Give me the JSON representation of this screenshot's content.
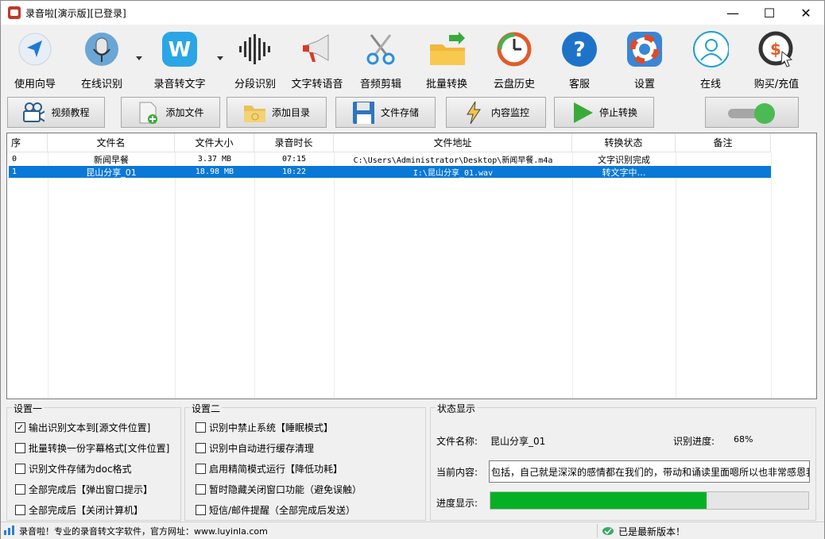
{
  "window": {
    "title": "录音啦[演示版][已登录]",
    "controls": [
      "—",
      "☐",
      "✕"
    ]
  },
  "toolbar": [
    {
      "label": "使用向导",
      "icon": "navigation-arrow-icon"
    },
    {
      "label": "在线识别",
      "icon": "microphone-icon"
    },
    {
      "label": "录音转文字",
      "icon": "w-logo-icon"
    },
    {
      "label": "分段识别",
      "icon": "soundwave-icon"
    },
    {
      "label": "文字转语音",
      "icon": "megaphone-icon"
    },
    {
      "label": "音频剪辑",
      "icon": "scissors-icon"
    },
    {
      "label": "批量转换",
      "icon": "folder-arrow-icon"
    },
    {
      "label": "云盘历史",
      "icon": "history-clock-icon"
    },
    {
      "label": "客服",
      "icon": "help-question-icon"
    },
    {
      "label": "设置",
      "icon": "lifebuoy-icon"
    },
    {
      "label": "在线",
      "icon": "user-profile-icon"
    },
    {
      "label": "购买/充值",
      "icon": "dollar-cursor-icon"
    }
  ],
  "actions": {
    "video_tutorial": "视频教程",
    "add_file": "添加文件",
    "add_folder": "添加目录",
    "file_storage": "文件存储",
    "content_monitor": "内容监控",
    "stop_convert": "停止转换"
  },
  "toggle": {
    "state": "on",
    "color": "#4cba52"
  },
  "table": {
    "headers": [
      "序",
      "文件名",
      "文件大小",
      "录音时长",
      "文件地址",
      "转换状态",
      "备注"
    ],
    "rows": [
      {
        "idx": "0",
        "name": "新闻早餐",
        "size": "3.37 MB",
        "duration": "07:15",
        "path": "C:\\Users\\Administrator\\Desktop\\新闻早餐.m4a",
        "status": "文字识别完成",
        "note": "",
        "selected": false
      },
      {
        "idx": "1",
        "name": "昆山分享_01",
        "size": "18.98 MB",
        "duration": "10:22",
        "path": "I:\\昆山分享_01.wav",
        "status": "转文字中…",
        "note": "",
        "selected": true
      }
    ]
  },
  "settings1": {
    "title": "设置一",
    "options": [
      {
        "label": "输出识别文本到[源文件位置]",
        "checked": true
      },
      {
        "label": "批量转换一份字幕格式[文件位置]",
        "checked": false
      },
      {
        "label": "识别文件存储为doc格式",
        "checked": false
      },
      {
        "label": "全部完成后【弹出窗口提示】",
        "checked": false
      },
      {
        "label": "全部完成后【关闭计算机】",
        "checked": false
      }
    ]
  },
  "settings2": {
    "title": "设置二",
    "options": [
      {
        "label": "识别中禁止系统【睡眠模式】",
        "checked": false
      },
      {
        "label": "识别中自动进行缓存清理",
        "checked": false
      },
      {
        "label": "启用精简模式运行【降低功耗】",
        "checked": false
      },
      {
        "label": "暂时隐藏关闭窗口功能（避免误触）",
        "checked": false
      },
      {
        "label": "短信/邮件提醒（全部完成后发送）",
        "checked": false
      }
    ]
  },
  "status": {
    "title": "状态显示",
    "file_name_label": "文件名称:",
    "file_name": "昆山分享_01",
    "progress_label": "识别进度:",
    "progress_text": "68%",
    "content_label": "当前内容:",
    "content_text": "包括，自己就是深深的感情都在我们的，带动和诵读里面嗯所以也非常感恩我",
    "bar_label": "进度显示:",
    "progress_value": 0.68,
    "bar_color": "#06b025"
  },
  "statusbar": {
    "left": "录音啦！专业的录音转文字软件，官方网址：www.luyinla.com",
    "right": "已是最新版本！"
  }
}
